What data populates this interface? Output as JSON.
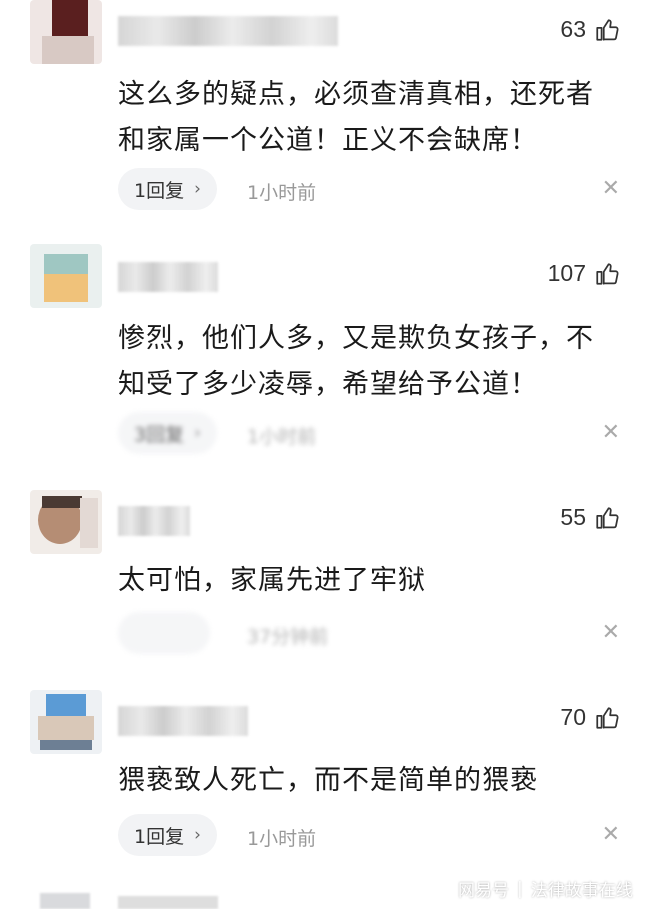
{
  "icons": {
    "like": "thumbs-up-icon",
    "close": "close-x-icon"
  },
  "colors": {
    "text": "#1a1a1a",
    "meta": "#999999",
    "pill_bg": "#f2f3f5"
  },
  "comments": [
    {
      "likes": "63",
      "lines": [
        "这么多的疑点，必须查清真相，还死者",
        "和家属一个公道！正义不会缺席！"
      ],
      "reply_label": "1回复",
      "time": "1小时前"
    },
    {
      "likes": "107",
      "lines": [
        "惨烈，他们人多，又是欺负女孩子，不",
        "知受了多少凌辱，希望给予公道！"
      ],
      "reply_label": "3回复",
      "time": "1小时前"
    },
    {
      "likes": "55",
      "lines": [
        "太可怕，家属先进了牢狱"
      ],
      "reply_label": "",
      "time": "37分钟前"
    },
    {
      "likes": "70",
      "lines": [
        "猥亵致人死亡，而不是简单的猥亵"
      ],
      "reply_label": "1回复",
      "time": "1小时前"
    }
  ],
  "symbols": {
    "chevron": "›",
    "close": "✕"
  },
  "watermark": {
    "brand": "网易号",
    "separator": "|",
    "account": "法律故事在线"
  }
}
